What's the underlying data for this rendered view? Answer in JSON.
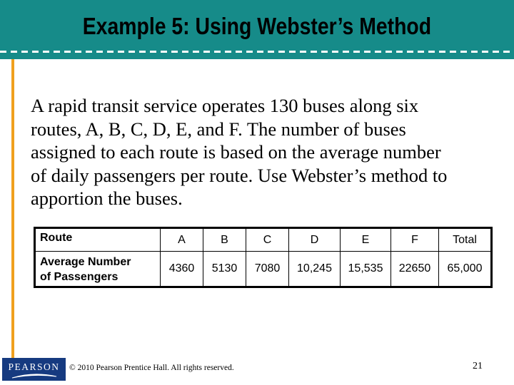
{
  "slide": {
    "title": "Example 5: Using Webster’s Method",
    "body_lines": [
      "A rapid transit service operates 130 buses along six",
      "routes, A, B, C, D, E, and F. The number of buses",
      "assigned to each route is based on the average number",
      "of daily passengers per route. Use Webster’s method to",
      "apportion the buses."
    ],
    "table": {
      "header_label": "Route",
      "columns": [
        "A",
        "B",
        "C",
        "D",
        "E",
        "F",
        "Total"
      ],
      "row_label_line1": "Average Number",
      "row_label_line2": "of Passengers",
      "values": [
        "4360",
        "5130",
        "7080",
        "10,245",
        "15,535",
        "22650",
        "65,000"
      ]
    },
    "footer": {
      "logo_text": "PEARSON",
      "copyright": "© 2010 Pearson Prentice Hall. All rights reserved.",
      "page_number": "21"
    }
  },
  "colors": {
    "header_teal": "#168b89",
    "accent_orange": "#f0a01e",
    "logo_navy": "#163a80"
  }
}
